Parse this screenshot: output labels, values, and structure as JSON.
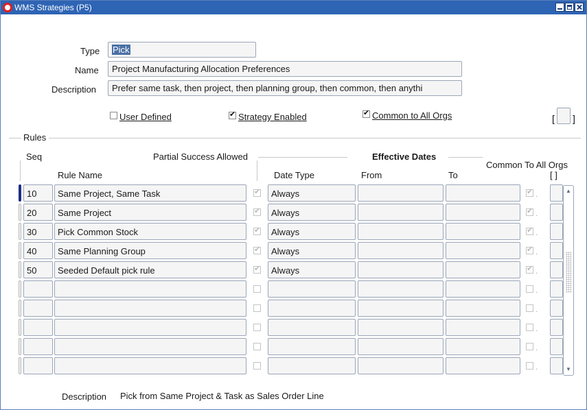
{
  "window": {
    "title": "WMS Strategies (P5)"
  },
  "header": {
    "type_label": "Type",
    "type_value": "Pick",
    "name_label": "Name",
    "name_value": "Project Manufacturing Allocation Preferences",
    "description_label": "Description",
    "description_value": "Prefer same task, then project, then planning group, then common, then anythi"
  },
  "options": {
    "user_defined": {
      "label": "User Defined",
      "checked": false
    },
    "strategy_enabled": {
      "label": "Strategy Enabled",
      "checked": true
    },
    "common_to_all_orgs": {
      "label": "Common to All Orgs",
      "checked": true
    },
    "flex_left": "[",
    "flex_right": "]"
  },
  "rules": {
    "section_label": "Rules",
    "headers": {
      "seq": "Seq",
      "partial_success": "Partial Success Allowed",
      "effective_dates": "Effective Dates",
      "common_to_all_orgs": "Common To All Orgs",
      "rule_name": "Rule Name",
      "date_type": "Date Type",
      "from": "From",
      "to": "To",
      "flex": "[ ]"
    },
    "rows": [
      {
        "seq": "10",
        "rule_name": "Same Project, Same Task",
        "partial": true,
        "date_type": "Always",
        "from": "",
        "to": "",
        "common": true,
        "current": true
      },
      {
        "seq": "20",
        "rule_name": "Same Project",
        "partial": true,
        "date_type": "Always",
        "from": "",
        "to": "",
        "common": true,
        "current": false
      },
      {
        "seq": "30",
        "rule_name": "Pick Common Stock",
        "partial": true,
        "date_type": "Always",
        "from": "",
        "to": "",
        "common": true,
        "current": false
      },
      {
        "seq": "40",
        "rule_name": "Same Planning Group",
        "partial": true,
        "date_type": "Always",
        "from": "",
        "to": "",
        "common": true,
        "current": false
      },
      {
        "seq": "50",
        "rule_name": "Seeded Default pick rule",
        "partial": true,
        "date_type": "Always",
        "from": "",
        "to": "",
        "common": true,
        "current": false
      },
      {
        "seq": "",
        "rule_name": "",
        "partial": false,
        "date_type": "",
        "from": "",
        "to": "",
        "common": false,
        "current": false
      },
      {
        "seq": "",
        "rule_name": "",
        "partial": false,
        "date_type": "",
        "from": "",
        "to": "",
        "common": false,
        "current": false
      },
      {
        "seq": "",
        "rule_name": "",
        "partial": false,
        "date_type": "",
        "from": "",
        "to": "",
        "common": false,
        "current": false
      },
      {
        "seq": "",
        "rule_name": "",
        "partial": false,
        "date_type": "",
        "from": "",
        "to": "",
        "common": false,
        "current": false
      },
      {
        "seq": "",
        "rule_name": "",
        "partial": false,
        "date_type": "",
        "from": "",
        "to": "",
        "common": false,
        "current": false
      }
    ]
  },
  "footer": {
    "description_label": "Description",
    "description_value": "Pick from Same Project & Task as Sales Order Line"
  },
  "colors": {
    "titlebar": "#2e64b4",
    "current_row_marker": "#1e2e8a",
    "field_bg": "#f5f5f5"
  }
}
